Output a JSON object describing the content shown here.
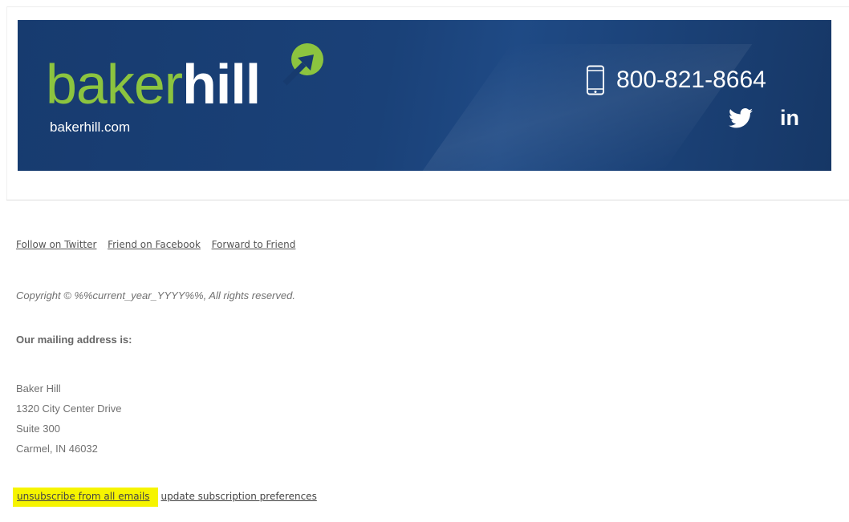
{
  "banner": {
    "logo_part1": "baker",
    "logo_part2": "hill",
    "site": "bakerhill.com",
    "phone": "800-821-8664",
    "linkedin_label": "in",
    "colors": {
      "background": "#1a4178",
      "logo_green": "#8cc43f",
      "text": "#ffffff"
    },
    "icons": [
      "growth-arrow-icon",
      "mobile-phone-icon",
      "twitter-icon",
      "linkedin-icon"
    ]
  },
  "social_links": {
    "twitter": "Follow on Twitter",
    "facebook": "Friend on Facebook",
    "forward": "Forward to Friend"
  },
  "copyright": "Copyright © %%current_year_YYYY%%, All rights reserved.",
  "mailing": {
    "heading": "Our mailing address is:",
    "address_lines": [
      "Baker Hill",
      "1320 City Center Drive",
      "Suite 300",
      "Carmel, IN 46032"
    ]
  },
  "footer": {
    "unsubscribe": "unsubscribe from all emails",
    "preferences": "update subscription preferences",
    "highlight_color": "#f6f400"
  }
}
